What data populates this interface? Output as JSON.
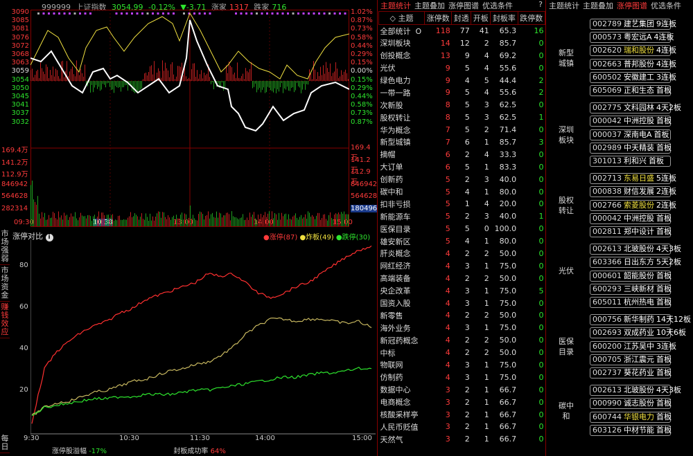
{
  "minute_chart": {
    "code": "999999",
    "name": "上证指数",
    "price": "3054.99",
    "change_pct": "-0.12%",
    "change": "▼-3.71",
    "up_label": "涨家",
    "up_count": "1317",
    "down_label": "跌家",
    "down_count": "716",
    "price_labels": [
      "3090",
      "3085",
      "3081",
      "3076",
      "3072",
      "3068",
      "3063",
      "3059",
      "3054",
      "3050",
      "3045",
      "3041",
      "3037",
      "3032"
    ],
    "pct_labels": [
      "1.02%",
      "0.87%",
      "0.73%",
      "0.58%",
      "0.44%",
      "0.29%",
      "0.15%",
      "0.00%",
      "0.15%",
      "0.29%",
      "0.44%",
      "0.58%",
      "0.73%",
      "0.87%"
    ],
    "volume_labels": [
      "169.4万",
      "141.2万",
      "112.9万",
      "846942",
      "564628",
      "282314"
    ],
    "volume_right": [
      "169.4万",
      "141.2万",
      "112.9万",
      "846942",
      "564628",
      "180496"
    ],
    "time_labels": [
      "09:30",
      "10:38",
      "13:00",
      "14:00",
      "15:00"
    ]
  },
  "limit_compare": {
    "title": "涨停对比",
    "legend": {
      "zt": "●涨停(87)",
      "zb": "●炸板(49)",
      "dt": "●跌停(30)"
    },
    "y_labels": [
      "80",
      "60",
      "40",
      "20"
    ],
    "x_labels": [
      "9:30",
      "10:30",
      "11:30",
      "14:00",
      "15:00"
    ],
    "footer_label1": "涨停股溢幅",
    "footer_value1": "-17%",
    "footer_label2": "封板成功率",
    "footer_value2": "64%",
    "side_tabs": [
      "市场强弱",
      "市场资金",
      "赚钱效应",
      "每日"
    ]
  },
  "chart_data": {
    "type": "line",
    "title": "涨停对比",
    "x_ticks": [
      "9:30",
      "10:30",
      "11:30",
      "14:00",
      "15:00"
    ],
    "ylim": [
      0,
      90
    ],
    "series": [
      {
        "name": "涨停(87)",
        "color": "#ff3030",
        "values": [
          5,
          30,
          38,
          43,
          47,
          50,
          52,
          56,
          58,
          62,
          64,
          66,
          68,
          70,
          74,
          73,
          74,
          70,
          65,
          63,
          65,
          68,
          70,
          74,
          78,
          82,
          85,
          87
        ]
      },
      {
        "name": "炸板(49)",
        "color": "#c8b860",
        "values": [
          8,
          12,
          14,
          15,
          17,
          19,
          20,
          22,
          24,
          25,
          27,
          29,
          30,
          32,
          33,
          36,
          40,
          46,
          50,
          53,
          53,
          52,
          53,
          53,
          52,
          51,
          52,
          49
        ]
      },
      {
        "name": "跌停(30)",
        "color": "#2ee62e",
        "values": [
          8,
          12,
          13,
          14,
          15,
          16,
          16,
          17,
          17,
          18,
          18,
          18,
          19,
          20,
          20,
          21,
          22,
          23,
          24,
          25,
          26,
          26,
          27,
          28,
          28,
          29,
          30,
          30
        ]
      }
    ]
  },
  "theme_table": {
    "tabs": [
      "主题统计",
      "主题叠加",
      "涨停图谱",
      "优选条件",
      "?"
    ],
    "headers": [
      "主题",
      "涨停数",
      "封透",
      "开板",
      "封板率",
      "跌停数"
    ],
    "rows": [
      [
        "全部统计",
        "118",
        "77",
        "41",
        "65.3",
        "16"
      ],
      [
        "深圳板块",
        "14",
        "12",
        "2",
        "85.7",
        "0"
      ],
      [
        "创投概念",
        "13",
        "9",
        "4",
        "69.2",
        "0"
      ],
      [
        "光伏",
        "9",
        "5",
        "4",
        "55.6",
        "0"
      ],
      [
        "绿色电力",
        "9",
        "4",
        "5",
        "44.4",
        "2"
      ],
      [
        "一带一路",
        "9",
        "5",
        "4",
        "55.6",
        "2"
      ],
      [
        "次新股",
        "8",
        "5",
        "3",
        "62.5",
        "0"
      ],
      [
        "股权转让",
        "8",
        "5",
        "3",
        "62.5",
        "1"
      ],
      [
        "华为概念",
        "7",
        "5",
        "2",
        "71.4",
        "0"
      ],
      [
        "新型城镇",
        "7",
        "6",
        "1",
        "85.7",
        "3"
      ],
      [
        "摘帽",
        "6",
        "2",
        "4",
        "33.3",
        "0"
      ],
      [
        "大订单",
        "6",
        "5",
        "1",
        "83.3",
        "0"
      ],
      [
        "创新药",
        "5",
        "2",
        "3",
        "40.0",
        "0"
      ],
      [
        "碳中和",
        "5",
        "4",
        "1",
        "80.0",
        "0"
      ],
      [
        "扣非亏损",
        "5",
        "1",
        "4",
        "20.0",
        "0"
      ],
      [
        "新能源车",
        "5",
        "2",
        "3",
        "40.0",
        "1"
      ],
      [
        "医保目录",
        "5",
        "5",
        "0",
        "100.0",
        "0"
      ],
      [
        "雄安新区",
        "5",
        "4",
        "1",
        "80.0",
        "0"
      ],
      [
        "肝炎概念",
        "4",
        "2",
        "2",
        "50.0",
        "0"
      ],
      [
        "网红经济",
        "4",
        "3",
        "1",
        "75.0",
        "0"
      ],
      [
        "高端装备",
        "4",
        "2",
        "2",
        "50.0",
        "0"
      ],
      [
        "央企改革",
        "4",
        "3",
        "1",
        "75.0",
        "5"
      ],
      [
        "国资入股",
        "4",
        "3",
        "1",
        "75.0",
        "0"
      ],
      [
        "新零售",
        "4",
        "2",
        "2",
        "50.0",
        "0"
      ],
      [
        "海外业务",
        "4",
        "3",
        "1",
        "75.0",
        "0"
      ],
      [
        "新冠药概念",
        "4",
        "2",
        "2",
        "50.0",
        "0"
      ],
      [
        "中标",
        "4",
        "2",
        "2",
        "50.0",
        "0"
      ],
      [
        "物联网",
        "4",
        "3",
        "1",
        "75.0",
        "0"
      ],
      [
        "仿制药",
        "4",
        "3",
        "1",
        "75.0",
        "0"
      ],
      [
        "数据中心",
        "3",
        "2",
        "1",
        "66.7",
        "0"
      ],
      [
        "电商概念",
        "3",
        "2",
        "1",
        "66.7",
        "0"
      ],
      [
        "核酸采样亭",
        "3",
        "2",
        "1",
        "66.7",
        "0"
      ],
      [
        "人民币贬值",
        "3",
        "2",
        "1",
        "66.7",
        "0"
      ],
      [
        "天然气",
        "3",
        "2",
        "1",
        "66.7",
        "0"
      ]
    ]
  },
  "right_panel": {
    "tabs": [
      "主题统计",
      "主题叠加",
      "涨停图谱",
      "优选条件"
    ],
    "groups": [
      {
        "label": "新型城镇",
        "stocks": [
          {
            "code": "002789",
            "name": "建艺集团",
            "board": "9连板",
            "hl": false
          },
          {
            "code": "000573",
            "name": "粤宏远A",
            "board": "4连板",
            "hl": false
          },
          {
            "code": "002620",
            "name": "瑞和股份",
            "board": "4连板",
            "hl": true
          },
          {
            "code": "002663",
            "name": "普邦股份",
            "board": "4连板",
            "hl": false
          },
          {
            "code": "600502",
            "name": "安徽建工",
            "board": "3连板",
            "hl": false
          },
          {
            "code": "605069",
            "name": "正和生态",
            "board": "首板",
            "hl": false
          }
        ]
      },
      {
        "label": "深圳板块",
        "stocks": [
          {
            "code": "002775",
            "name": "文科园林",
            "board": "4天2板",
            "hl": false
          },
          {
            "code": "000042",
            "name": "中洲控股",
            "board": "首板",
            "hl": false
          },
          {
            "code": "000037",
            "name": "深南电A",
            "board": "首板",
            "hl": false
          },
          {
            "code": "002989",
            "name": "中天精装",
            "board": "首板",
            "hl": false
          },
          {
            "code": "301013",
            "name": "利和兴",
            "board": "首板",
            "hl": false
          }
        ]
      },
      {
        "label": "股权转让",
        "stocks": [
          {
            "code": "002713",
            "name": "东易日盛",
            "board": "5连板",
            "hl": true
          },
          {
            "code": "000838",
            "name": "财信发展",
            "board": "2连板",
            "hl": false
          },
          {
            "code": "002766",
            "name": "索菱股份",
            "board": "2连板",
            "hl": true
          },
          {
            "code": "000042",
            "name": "中洲控股",
            "board": "首板",
            "hl": false
          },
          {
            "code": "002811",
            "name": "郑中设计",
            "board": "首板",
            "hl": false
          }
        ]
      },
      {
        "label": "光伏",
        "stocks": [
          {
            "code": "002613",
            "name": "北玻股份",
            "board": "4天3板",
            "hl": false
          },
          {
            "code": "603366",
            "name": "日出东方",
            "board": "5天2板",
            "hl": false
          },
          {
            "code": "000601",
            "name": "韶能股份",
            "board": "首板",
            "hl": false
          },
          {
            "code": "600293",
            "name": "三峡新材",
            "board": "首板",
            "hl": false
          },
          {
            "code": "605011",
            "name": "杭州热电",
            "board": "首板",
            "hl": false
          }
        ]
      },
      {
        "label": "医保目录",
        "stocks": [
          {
            "code": "000756",
            "name": "新华制药",
            "board": "14天12板",
            "hl": false
          },
          {
            "code": "002693",
            "name": "双成药业",
            "board": "10天6板",
            "hl": false
          },
          {
            "code": "600200",
            "name": "江苏吴中",
            "board": "3连板",
            "hl": false
          },
          {
            "code": "000705",
            "name": "浙江震元",
            "board": "首板",
            "hl": false
          },
          {
            "code": "002737",
            "name": "葵花药业",
            "board": "首板",
            "hl": false
          }
        ]
      },
      {
        "label": "碳中和",
        "stocks": [
          {
            "code": "002613",
            "name": "北玻股份",
            "board": "4天3板",
            "hl": false
          },
          {
            "code": "000990",
            "name": "诚志股份",
            "board": "首板",
            "hl": false
          },
          {
            "code": "600744",
            "name": "华银电力",
            "board": "首板",
            "hl": true
          },
          {
            "code": "603126",
            "name": "中材节能",
            "board": "首板",
            "hl": false
          }
        ]
      }
    ]
  }
}
